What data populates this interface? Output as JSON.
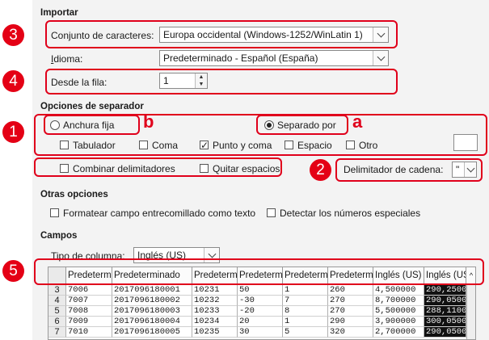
{
  "importar": {
    "section": "Importar",
    "charset_label": "Conjunto de caracteres:",
    "charset_value": "Europa occidental (Windows-1252/WinLatin 1)",
    "idioma_label": "Idioma:",
    "idioma_value": "Predeterminado - Español (España)",
    "desde_label": "Desde la fila:",
    "desde_value": "1"
  },
  "separador": {
    "section": "Opciones de separador",
    "anchura_fija": "Anchura fija",
    "separado_por": "Separado por",
    "selected": "separado_por",
    "options": [
      {
        "label": "Tabulador",
        "checked": false
      },
      {
        "label": "Coma",
        "checked": false
      },
      {
        "label": "Punto y coma",
        "checked": true
      },
      {
        "label": "Espacio",
        "checked": false
      },
      {
        "label": "Otro",
        "checked": false
      }
    ],
    "combinar": "Combinar delimitadores",
    "quitar": "Quitar espacios",
    "delim_label": "Delimitador de cadena:",
    "delim_value": "\""
  },
  "otras": {
    "section": "Otras opciones",
    "formatear": "Formatear campo entrecomillado como texto",
    "detectar": "Detectar los números especiales"
  },
  "campos": {
    "section": "Campos",
    "tipo_label": "Tipo de columna:",
    "tipo_value": "Inglés (US)",
    "headers": [
      "Predeterm",
      "Predeterminado",
      "Predeterm",
      "Predeterm",
      "Predeterm",
      "Predeterm",
      "Inglés (US)",
      "Inglés (US"
    ],
    "rows": [
      {
        "n": "3",
        "cells": [
          "7006",
          "2017096180001",
          "10231",
          "50",
          "1",
          "260",
          "4,500000",
          "290,2500"
        ]
      },
      {
        "n": "4",
        "cells": [
          "7007",
          "2017096180002",
          "10232",
          "-30",
          "7",
          "270",
          "8,700000",
          "290,0500"
        ]
      },
      {
        "n": "5",
        "cells": [
          "7008",
          "2017096180003",
          "10233",
          "-20",
          "8",
          "270",
          "5,500000",
          "288,1100"
        ]
      },
      {
        "n": "6",
        "cells": [
          "7009",
          "2017096180004",
          "10234",
          "20",
          "1",
          "290",
          "3,900000",
          "300,0500"
        ]
      },
      {
        "n": "7",
        "cells": [
          "7010",
          "2017096180005",
          "10235",
          "30",
          "5",
          "320",
          "2,700000",
          "290,0500"
        ]
      }
    ]
  },
  "annotations": {
    "badges": [
      "3",
      "4",
      "1",
      "2",
      "5"
    ],
    "letters": [
      "a",
      "b"
    ]
  },
  "colors": {
    "annotation_red": "#e0001b",
    "panel_bg": "#f3f3f3"
  }
}
